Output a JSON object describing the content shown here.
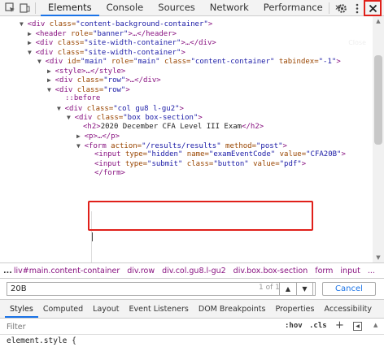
{
  "toolbar": {
    "tabs": [
      "Elements",
      "Console",
      "Sources",
      "Network",
      "Performance"
    ],
    "more": "»",
    "close_tooltip": "Close"
  },
  "tree": {
    "l1": {
      "tag": "<div ",
      "attr": "class=",
      "val": "\"content-background-container\"",
      "end": ">"
    },
    "l2": {
      "pre": "▶ ",
      "tag": "<header ",
      "attr": "role=",
      "val": "\"banner\"",
      "end": ">…</header>"
    },
    "l3": {
      "pre": "▶ ",
      "tag": "<div ",
      "attr": "class=",
      "val": "\"site-width-container\"",
      "end": ">…</div>"
    },
    "l4": {
      "pre": "▼ ",
      "tag": "<div ",
      "attr": "class=",
      "val": "\"site-width-container\"",
      "end": ">"
    },
    "l5": {
      "pre": "▼ ",
      "tag": "<div ",
      "attr1": "id=",
      "val1": "\"main\"",
      "attr2": " role=",
      "val2": "\"main\"",
      "attr3": " class=",
      "val3": "\"content-container\"",
      "attr4": " tabindex=",
      "val4": "\"-1\"",
      "end": ">"
    },
    "l6": {
      "pre": "▶ ",
      "tag": "<style>…</style>"
    },
    "l7": {
      "pre": "▶ ",
      "tag": "<div ",
      "attr": "class=",
      "val": "\"row\"",
      "end": ">…</div>"
    },
    "l8": {
      "pre": "▼ ",
      "tag": "<div ",
      "attr": "class=",
      "val": "\"row\"",
      "end": ">"
    },
    "l9": {
      "tag": "::before"
    },
    "l10": {
      "pre": "▼ ",
      "tag": "<div ",
      "attr": "class=",
      "val": "\"col gu8 l-gu2\"",
      "end": ">"
    },
    "l11": {
      "pre": "▼ ",
      "tag": "<div ",
      "attr": "class=",
      "val": "\"box box-section\"",
      "end": ">"
    },
    "l12": {
      "tag": "<h2>",
      "txt": "2020 December CFA Level III Exam",
      "end": "</h2>"
    },
    "l13": {
      "pre": "▶ ",
      "tag": "<p>…</p>"
    },
    "l14": {
      "pre": "▼ ",
      "tag": "<form ",
      "attr1": "action=",
      "val1": "\"/results/results\"",
      "attr2": " method=",
      "val2": "\"post\"",
      "end": ">"
    },
    "l15": {
      "tag": "<input ",
      "attr1": "type=",
      "val1": "\"hidden\"",
      "attr2": " name=",
      "val2": "\"examEventCode\"",
      "attr3": " value=",
      "val3": "\"CFA20B\"",
      "end": ">"
    },
    "l16": {
      "tag": "<input ",
      "attr1": "type=",
      "val1": "\"submit\"",
      "attr2": " class=",
      "val2": "\"button\"",
      "attr3": " value=",
      "val3": "\"pdf\"",
      "end": ">"
    },
    "l17": {
      "tag": "</form>"
    }
  },
  "crumbs": {
    "first": "...",
    "items": [
      "liv#main.content-container",
      "div.row",
      "div.col.gu8.l-gu2",
      "div.box.box-section",
      "form",
      "input",
      "..."
    ]
  },
  "search": {
    "value": "20B",
    "count": "1 of 1",
    "cancel": "Cancel"
  },
  "styles_tabs": [
    "Styles",
    "Computed",
    "Layout",
    "Event Listeners",
    "DOM Breakpoints",
    "Properties",
    "Accessibility"
  ],
  "filter": {
    "placeholder": "Filter",
    "hov": ":hov",
    "cls": ".cls",
    "plus": "+"
  },
  "element_style": "element.style {"
}
